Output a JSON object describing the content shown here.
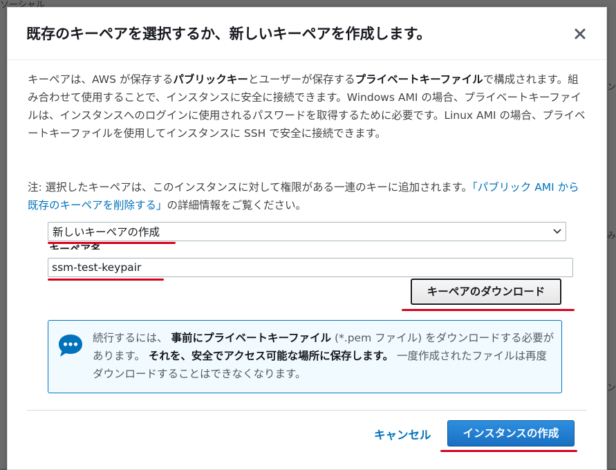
{
  "background": {
    "fragments": [
      "ソーシャル",
      "ン",
      "み",
      "ン"
    ]
  },
  "modal": {
    "title": "既存のキーペアを選択するか、新しいキーペアを作成します。",
    "description": {
      "p1": "キーペアは、AWS が保存する",
      "b1": "パブリックキー",
      "p2": "とユーザーが保存する",
      "b2": "プライベートキーファイル",
      "p3": "で構成されます。組み合わせて使用することで、インスタンスに安全に接続できます。Windows AMI の場合、プライベートキーファイルは、インスタンスへのログインに使用されるパスワードを取得するために必要です。Linux AMI の場合、プライベートキーファイルを使用してインスタンスに SSH で安全に接続できます。"
    },
    "note": {
      "prefix": "注: 選択したキーペアは、このインスタンスに対して権限がある一連のキーに追加されます。",
      "link": "「パブリック AMI から既存のキーペアを削除する」",
      "suffix": "の詳細情報をご覧ください。"
    },
    "keypair_select": {
      "selected": "新しいキーペアの作成"
    },
    "keypair_name": {
      "label": "キーペア名",
      "value": "ssm-test-keypair"
    },
    "download_button": "キーペアのダウンロード",
    "info": {
      "t1": "続行するには、",
      "b1": "事前にプライベートキーファイル",
      "t2": "(*.pem ファイル) をダウンロードする必要があります。",
      "b2": "それを、安全でアクセス可能な場所に保存します。",
      "t3": "一度作成されたファイルは再度ダウンロードすることはできなくなります。"
    },
    "footer": {
      "cancel": "キャンセル",
      "create": "インスタンスの作成"
    }
  },
  "colors": {
    "link": "#0073bb",
    "primary": "#1a6fc2",
    "annotation": "#d6001c",
    "info_bg": "#f1faff"
  }
}
